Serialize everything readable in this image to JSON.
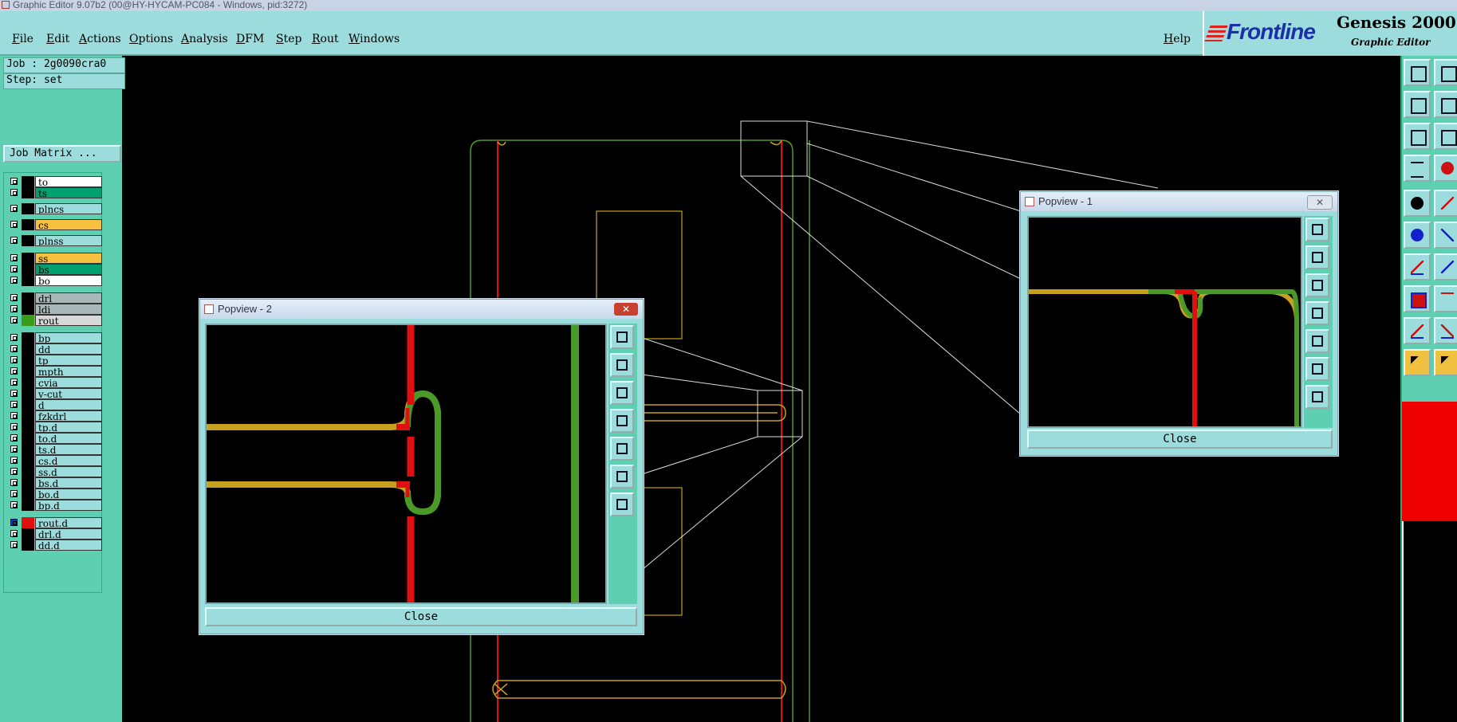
{
  "window": {
    "title": "Graphic Editor 9.07b2 (00@HY-HYCAM-PC084 - Windows, pid:3272)"
  },
  "menu": [
    {
      "label": "File"
    },
    {
      "label": "Edit"
    },
    {
      "label": "Actions"
    },
    {
      "label": "Options"
    },
    {
      "label": "Analysis"
    },
    {
      "label": "DFM"
    },
    {
      "label": "Step"
    },
    {
      "label": "Rout"
    },
    {
      "label": "Windows"
    },
    {
      "label": "Help"
    }
  ],
  "brand": {
    "logo": "Frontline",
    "product": "Genesis 2000",
    "subtitle": "Graphic Editor"
  },
  "job": {
    "job_label": "Job : 2g0090cra0",
    "step_label": "Step: set",
    "matrix_button": "Job Matrix ..."
  },
  "layers": [
    {
      "name": "to",
      "color": "#ffffff"
    },
    {
      "name": "ts",
      "color": "#00a070"
    },
    {
      "name": "plncs",
      "color": "#9cdcdc"
    },
    {
      "name": "cs",
      "color": "#f8c040"
    },
    {
      "name": "plnss",
      "color": "#9cdcdc"
    },
    {
      "name": "ss",
      "color": "#f8c040"
    },
    {
      "name": "bs",
      "color": "#00a070"
    },
    {
      "name": "bo",
      "color": "#ffffff"
    },
    {
      "name": "drl",
      "color": "#a8b8b8"
    },
    {
      "name": "ldi",
      "color": "#a8b8b8"
    },
    {
      "name": "rout",
      "color": "#d8d8d8",
      "work_color": "#3a9a1a"
    },
    {
      "name": "bp",
      "color": "#9cdcdc"
    },
    {
      "name": "dd",
      "color": "#9cdcdc"
    },
    {
      "name": "tp",
      "color": "#9cdcdc"
    },
    {
      "name": "mpth",
      "color": "#9cdcdc"
    },
    {
      "name": "cvia",
      "color": "#9cdcdc"
    },
    {
      "name": "v-cut",
      "color": "#9cdcdc"
    },
    {
      "name": "d",
      "color": "#9cdcdc"
    },
    {
      "name": "fzkdrl",
      "color": "#9cdcdc"
    },
    {
      "name": "tp.d",
      "color": "#9cdcdc"
    },
    {
      "name": "to.d",
      "color": "#9cdcdc"
    },
    {
      "name": "ts.d",
      "color": "#9cdcdc"
    },
    {
      "name": "cs.d",
      "color": "#9cdcdc"
    },
    {
      "name": "ss.d",
      "color": "#9cdcdc"
    },
    {
      "name": "bs.d",
      "color": "#9cdcdc"
    },
    {
      "name": "bo.d",
      "color": "#9cdcdc"
    },
    {
      "name": "bp.d",
      "color": "#9cdcdc"
    },
    {
      "name": "rout.d",
      "color": "#9cdcdc",
      "work_color": "#e01010",
      "active": true
    },
    {
      "name": "drl.d",
      "color": "#9cdcdc"
    },
    {
      "name": "dd.d",
      "color": "#9cdcdc"
    }
  ],
  "popview1": {
    "title": "Popview - 1",
    "close_x": "✕",
    "close_button": "Close"
  },
  "popview2": {
    "title": "Popview - 2",
    "close_x": "✕",
    "close_button": "Close"
  }
}
